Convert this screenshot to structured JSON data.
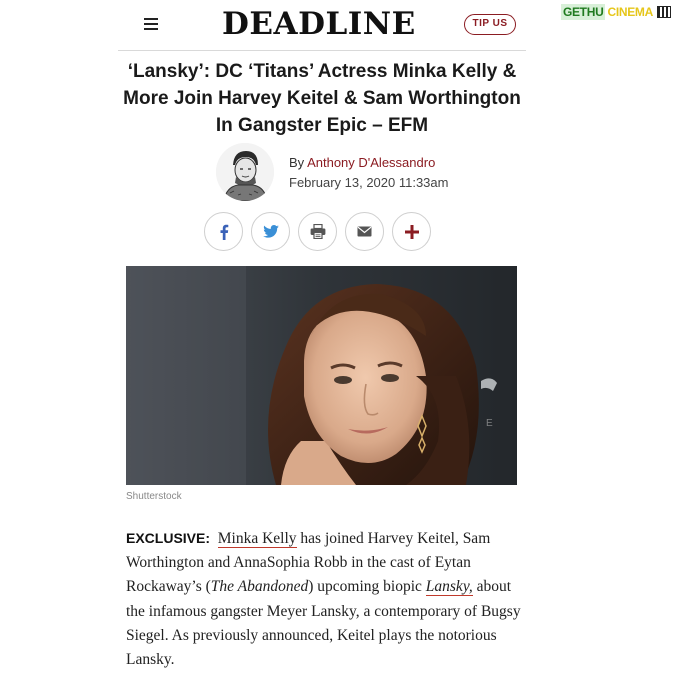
{
  "watermark": {
    "part1": "GETHU",
    "part2": "CINEMA"
  },
  "header": {
    "logo": "DEADLINE",
    "tip_label": "TIP US"
  },
  "article": {
    "headline": "‘Lansky’: DC ‘Titans’ Actress Minka Kelly & More Join Harvey Keitel & Sam Worthington In Gangster Epic – EFM",
    "by_prefix": "By ",
    "author": "Anthony D'Alessandro",
    "date": "February 13, 2020 11:33am",
    "photo_credit": "Shutterstock",
    "body": {
      "exclusive": "EXCLUSIVE:",
      "link_minka": "Minka Kelly",
      "t1": " has joined Harvey Keitel, Sam Worthington and AnnaSophia Robb in the cast of Eytan Rockaway’s (",
      "abandoned": "The Abandoned",
      "t2": ") upcoming biopic ",
      "lansky": "Lansky,",
      "t3": " about the infamous gangster Meyer Lansky, a contemporary of Bugsy Siegel. As previously announced, Keitel plays the notorious Lansky."
    }
  },
  "share": [
    {
      "icon": "facebook-icon"
    },
    {
      "icon": "twitter-icon"
    },
    {
      "icon": "print-icon"
    },
    {
      "icon": "email-icon"
    },
    {
      "icon": "plus-icon"
    }
  ],
  "colors": {
    "accent": "#8b1c22",
    "link_underline": "#c0392b"
  }
}
